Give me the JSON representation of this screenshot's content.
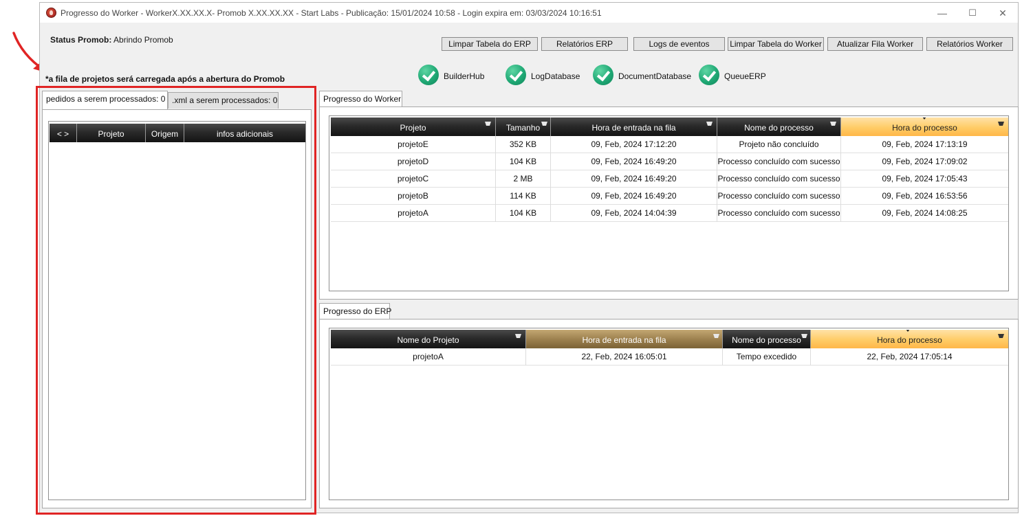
{
  "window": {
    "title": "Progresso do Worker  -  WorkerX.XX.XX.X- Promob X.XX.XX.XX -  Start Labs  -  Publicação: 15/01/2024 10:58  - Login expira em: 03/03/2024 10:16:51",
    "controls": {
      "minimize": "—",
      "maximize": "☐",
      "close": "✕"
    }
  },
  "status": {
    "label": "Status Promob:",
    "value": "Abrindo Promob"
  },
  "note": "*a fila de projetos será carregada após a abertura do Promob",
  "toolbar": {
    "buttons": [
      "Limpar Tabela do ERP",
      "Relatórios ERP",
      "Logs de eventos",
      "Limpar Tabela do Worker",
      "Atualizar Fila Worker",
      "Relatórios Worker"
    ]
  },
  "services": [
    "BuilderHub",
    "LogDatabase",
    "DocumentDatabase",
    "QueueERP"
  ],
  "left": {
    "tabs": [
      "pedidos a serem processados: 0",
      ".xml a serem processados: 0"
    ],
    "columns": [
      "< >",
      "Projeto",
      "Origem",
      "infos adicionais"
    ]
  },
  "worker": {
    "tab": "Progresso do Worker",
    "columns": [
      "Projeto",
      "Tamanho",
      "Hora de entrada na fila",
      "Nome do processo",
      "Hora do processo"
    ],
    "rows": [
      [
        "projetoE",
        "352 KB",
        "09, Feb, 2024 17:12:20",
        "Projeto não concluído",
        "09, Feb, 2024 17:13:19"
      ],
      [
        "projetoD",
        "104 KB",
        "09, Feb, 2024 16:49:20",
        "Processo concluído com sucesso",
        "09, Feb, 2024 17:09:02"
      ],
      [
        "projetoC",
        "2 MB",
        "09, Feb, 2024 16:49:20",
        "Processo concluído com sucesso",
        "09, Feb, 2024 17:05:43"
      ],
      [
        "projetoB",
        "114 KB",
        "09, Feb, 2024 16:49:20",
        "Processo concluído com sucesso",
        "09, Feb, 2024 16:53:56"
      ],
      [
        "projetoA",
        "104 KB",
        "09, Feb, 2024 14:04:39",
        "Processo concluído com sucesso",
        "09, Feb, 2024 14:08:25"
      ]
    ]
  },
  "erp": {
    "tab": "Progresso do ERP",
    "columns": [
      "Nome do Projeto",
      "Hora de entrada na fila",
      "Nome do processo",
      "Hora do processo"
    ],
    "rows": [
      [
        "projetoA",
        "22, Feb, 2024 16:05:01",
        "Tempo excedido",
        "22, Feb, 2024 17:05:14"
      ]
    ]
  },
  "colors": {
    "annotation_red": "#e02424",
    "header_dark": "#1f1f1f",
    "header_sorted": "#ffcc66",
    "check_green": "#1fa874"
  }
}
